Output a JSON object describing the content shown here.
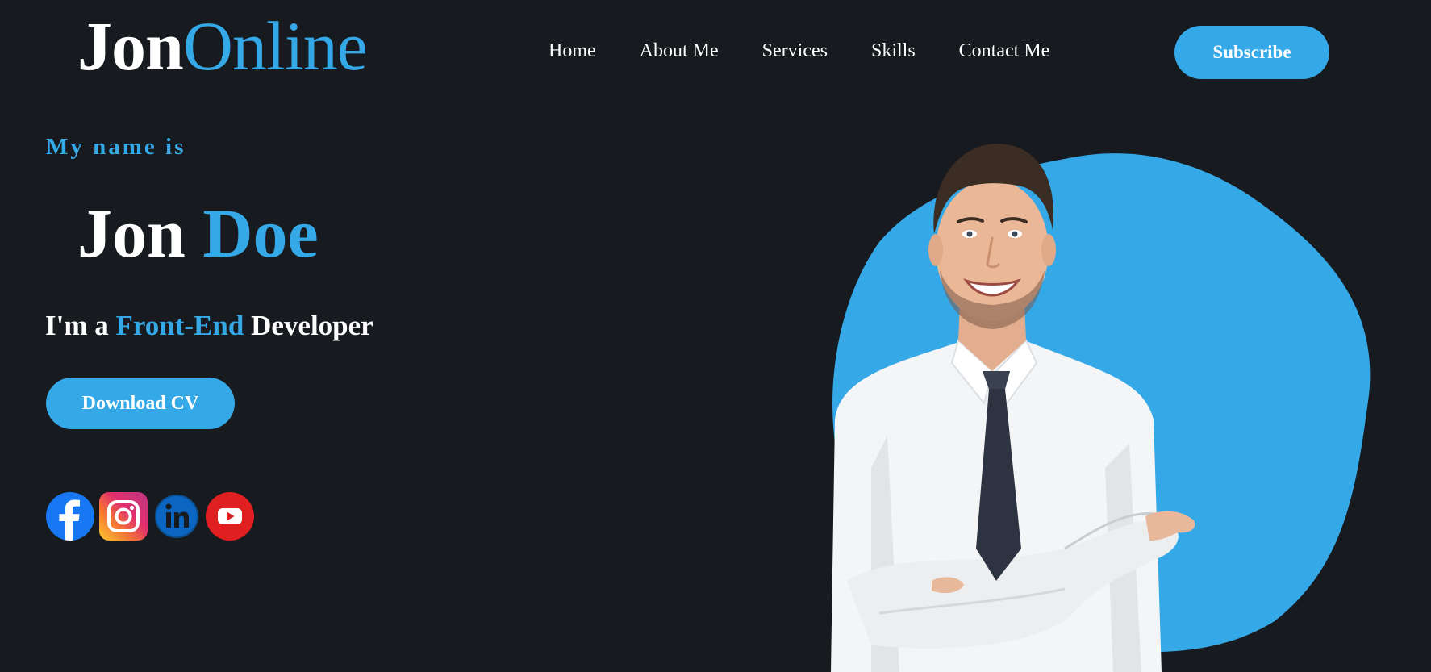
{
  "header": {
    "logo_part1": "Jon",
    "logo_part2": "Online",
    "nav": [
      {
        "label": "Home"
      },
      {
        "label": "About Me"
      },
      {
        "label": "Services"
      },
      {
        "label": "Skills"
      },
      {
        "label": "Contact Me"
      }
    ],
    "subscribe_label": "Subscribe"
  },
  "hero": {
    "intro": "My name is",
    "first_name": "Jon",
    "last_name": "Doe",
    "role_prefix": "I'm a",
    "role_highlight": "Front-End",
    "role_suffix": "Developer",
    "cv_button_label": "Download CV"
  },
  "socials": [
    {
      "icon": "facebook-icon",
      "color": "#1877f2"
    },
    {
      "icon": "instagram-icon",
      "color": "#e1306c"
    },
    {
      "icon": "linkedin-icon",
      "color": "#0a66c2"
    },
    {
      "icon": "youtube-icon",
      "color": "#e02020"
    }
  ],
  "colors": {
    "background": "#171a1e",
    "accent": "#35a8e8",
    "text": "#ffffff"
  }
}
